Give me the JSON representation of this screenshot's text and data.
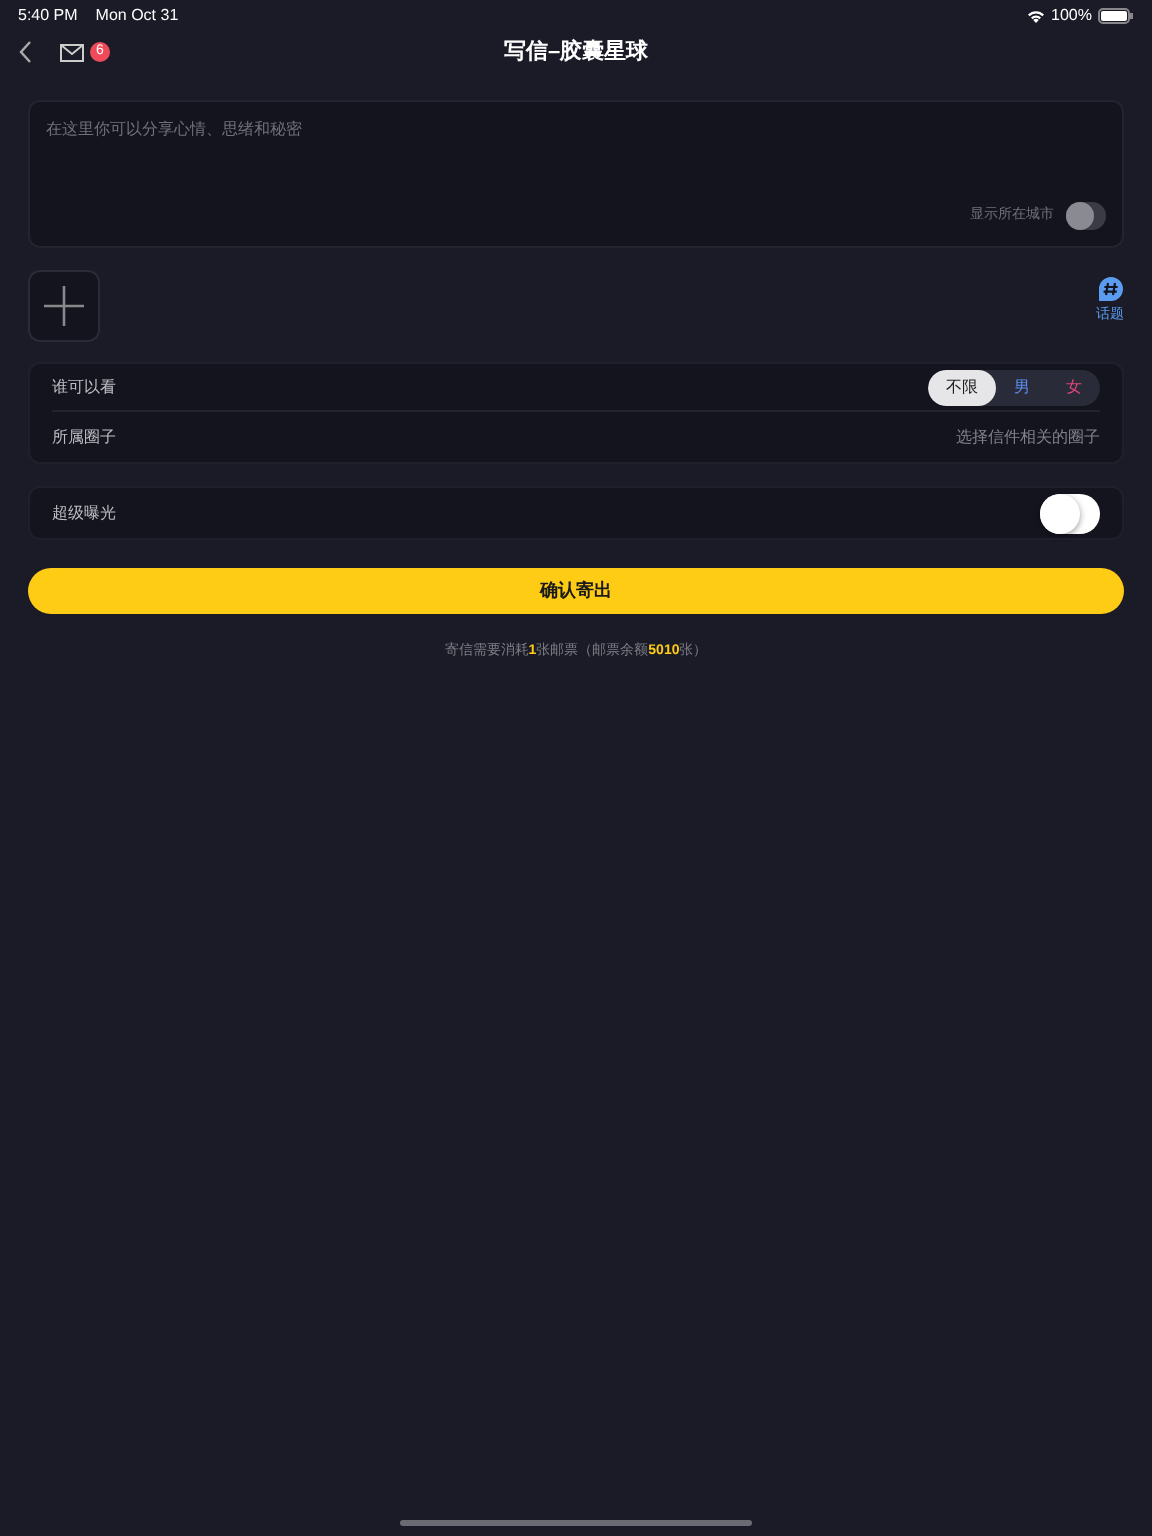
{
  "status_bar": {
    "time": "5:40 PM",
    "date": "Mon Oct 31",
    "battery": "100%"
  },
  "nav": {
    "title": "写信–胶囊星球",
    "mail_badge": "6"
  },
  "composer": {
    "placeholder": "在这里你可以分享心情、思绪和秘密",
    "show_city": {
      "label": "显示所在城市",
      "on": false
    }
  },
  "topic": {
    "label": "话题"
  },
  "visibility": {
    "label": "谁可以看",
    "options": [
      {
        "label": "不限",
        "selected": true,
        "color": "#1f1f1f"
      },
      {
        "label": "男",
        "selected": false,
        "color": "#5b8def"
      },
      {
        "label": "女",
        "selected": false,
        "color": "#e0457b"
      }
    ]
  },
  "circle": {
    "label": "所属圈子",
    "value": "选择信件相关的圈子"
  },
  "super_exposure": {
    "label": "超级曝光",
    "on": false
  },
  "submit": {
    "label": "确认寄出"
  },
  "footer_note": "寄信需要消耗**1**张邮票（邮票余额**5010**张）"
}
